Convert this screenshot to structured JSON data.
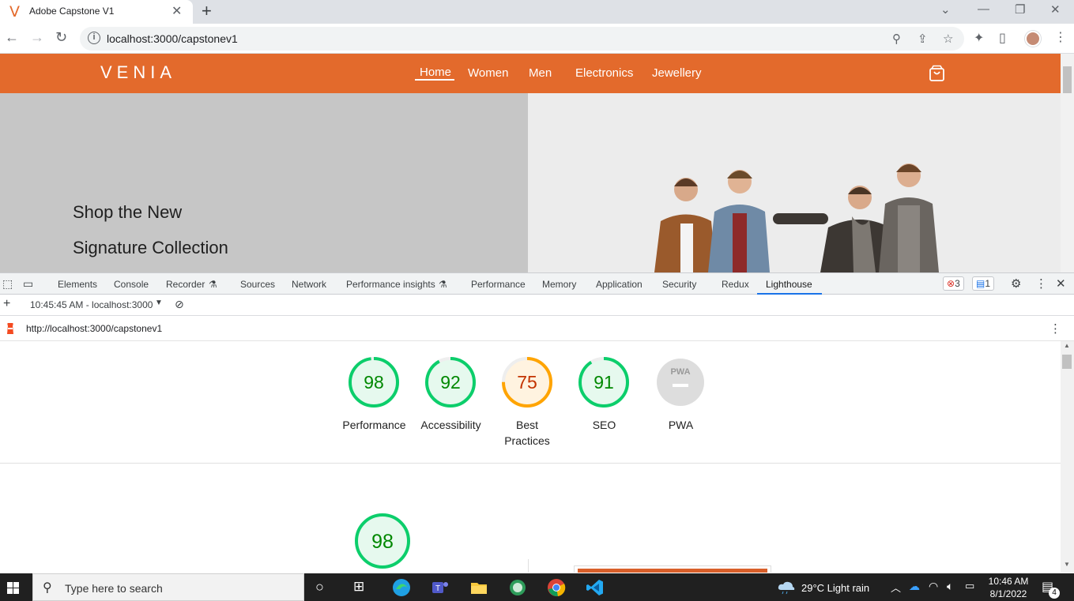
{
  "browser": {
    "tab_title": "Adobe Capstone V1",
    "tab_favicon_letter": "V",
    "url": "localhost:3000/capstonev1"
  },
  "site": {
    "logo": "VENIA",
    "nav": [
      "Home",
      "Women",
      "Men",
      "Electronics",
      "Jewellery"
    ],
    "active_nav": "Home",
    "hero_line1": "Shop the New",
    "hero_line2": "Signature Collection",
    "brand_color": "#e36a2c"
  },
  "devtools": {
    "tabs": [
      "Elements",
      "Console",
      "Recorder",
      "Sources",
      "Network",
      "Performance insights",
      "Performance",
      "Memory",
      "Application",
      "Security",
      "Redux",
      "Lighthouse"
    ],
    "active_tab": "Lighthouse",
    "error_count": "3",
    "message_count": "1",
    "report_time": "10:45:45 AM - localhost:3000",
    "report_url": "http://localhost:3000/capstonev1"
  },
  "lighthouse": {
    "scores": [
      {
        "label": "Performance",
        "score": "98",
        "status": "pass"
      },
      {
        "label": "Accessibility",
        "score": "92",
        "status": "pass"
      },
      {
        "label": "Best Practices",
        "score": "75",
        "status": "average"
      },
      {
        "label": "SEO",
        "score": "91",
        "status": "pass"
      },
      {
        "label": "PWA",
        "score": "",
        "status": "na",
        "badge": "PWA"
      }
    ],
    "detail_score": "98",
    "colors": {
      "pass": "#0cce6b",
      "pass_text": "#008800",
      "average": "#ffa400",
      "average_text": "#c33300",
      "na": "#dddddd"
    }
  },
  "taskbar": {
    "search_placeholder": "Type here to search",
    "weather": "29°C  Light rain",
    "time": "10:46 AM",
    "date": "8/1/2022",
    "notifications": "4"
  }
}
